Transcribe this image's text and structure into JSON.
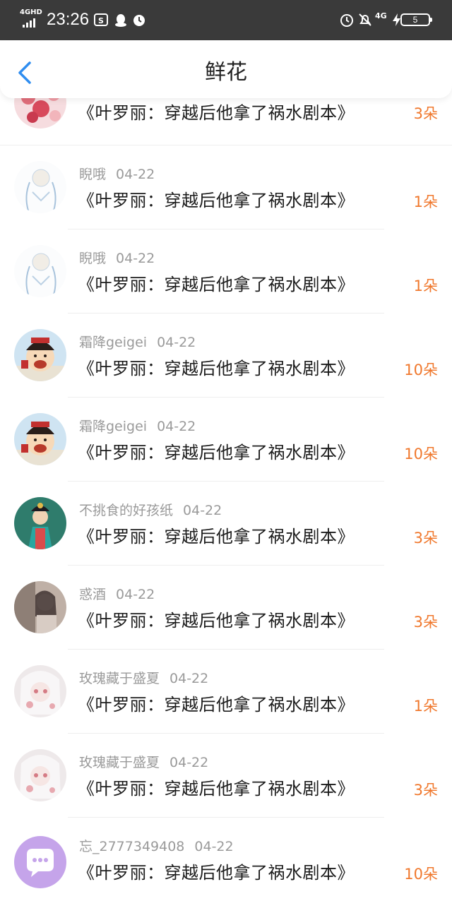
{
  "status_bar": {
    "network": "4GHD",
    "time": "23:26",
    "battery": "5",
    "right_network": "4G"
  },
  "header": {
    "title": "鲜花",
    "back_icon": "chevron-left-icon"
  },
  "colors": {
    "accent": "#2f8df0",
    "count": "#f0782d",
    "meta": "#9a9a9a"
  },
  "records": [
    {
      "user": "",
      "date": "",
      "book": "《叶罗丽：穿越后他拿了祸水剧本》",
      "count": "3朵",
      "avatar": "flower"
    },
    {
      "user": "睨哦",
      "date": "04-22",
      "book": "《叶罗丽：穿越后他拿了祸水剧本》",
      "count": "1朵",
      "avatar": "sketch"
    },
    {
      "user": "睨哦",
      "date": "04-22",
      "book": "《叶罗丽：穿越后他拿了祸水剧本》",
      "count": "1朵",
      "avatar": "sketch"
    },
    {
      "user": "霜降geigei",
      "date": "04-22",
      "book": "《叶罗丽：穿越后他拿了祸水剧本》",
      "count": "10朵",
      "avatar": "cartoon"
    },
    {
      "user": "霜降geigei",
      "date": "04-22",
      "book": "《叶罗丽：穿越后他拿了祸水剧本》",
      "count": "10朵",
      "avatar": "cartoon"
    },
    {
      "user": "不挑食的好孩纸",
      "date": "04-22",
      "book": "《叶罗丽：穿越后他拿了祸水剧本》",
      "count": "3朵",
      "avatar": "opera"
    },
    {
      "user": "惑酒",
      "date": "04-22",
      "book": "《叶罗丽：穿越后他拿了祸水剧本》",
      "count": "3朵",
      "avatar": "photo"
    },
    {
      "user": "玫瑰藏于盛夏",
      "date": "04-22",
      "book": "《叶罗丽：穿越后他拿了祸水剧本》",
      "count": "1朵",
      "avatar": "anime"
    },
    {
      "user": "玫瑰藏于盛夏",
      "date": "04-22",
      "book": "《叶罗丽：穿越后他拿了祸水剧本》",
      "count": "3朵",
      "avatar": "anime"
    },
    {
      "user": "忘_2777349408",
      "date": "04-22",
      "book": "《叶罗丽：穿越后他拿了祸水剧本》",
      "count": "10朵",
      "avatar": "default-chat"
    }
  ]
}
